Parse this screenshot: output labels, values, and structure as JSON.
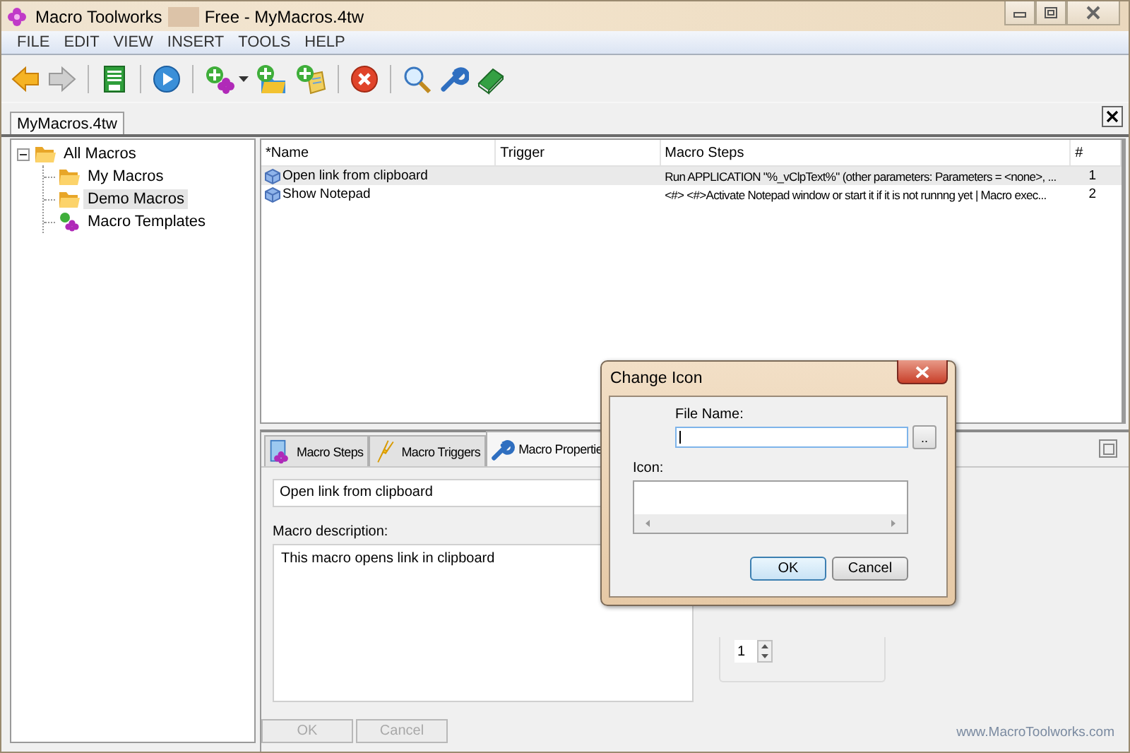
{
  "window": {
    "app_name": "Macro Toolworks",
    "title_rest": "Free - MyMacros.4tw"
  },
  "menu": [
    "FILE",
    "EDIT",
    "VIEW",
    "INSERT",
    "TOOLS",
    "HELP"
  ],
  "toolbar": [
    {
      "kind": "back",
      "disabled": false
    },
    {
      "kind": "forward",
      "disabled": true
    },
    {
      "kind": "sep"
    },
    {
      "kind": "save",
      "disabled": false
    },
    {
      "kind": "sep"
    },
    {
      "kind": "run",
      "disabled": false
    },
    {
      "kind": "sep"
    },
    {
      "kind": "add-macro",
      "disabled": false
    },
    {
      "kind": "dropdown",
      "disabled": false
    },
    {
      "kind": "add-folder",
      "disabled": false
    },
    {
      "kind": "add-template",
      "disabled": false
    },
    {
      "kind": "sep"
    },
    {
      "kind": "delete",
      "disabled": false
    },
    {
      "kind": "sep"
    },
    {
      "kind": "search",
      "disabled": false
    },
    {
      "kind": "settings",
      "disabled": false
    },
    {
      "kind": "help",
      "disabled": false
    }
  ],
  "document_tab": {
    "label": "MyMacros.4tw",
    "selected": true
  },
  "tree": [
    {
      "label": "All Macros",
      "kind": "folder",
      "expanded": true,
      "selected": false,
      "children": [
        {
          "label": "My Macros",
          "kind": "folder",
          "selected": false
        },
        {
          "label": "Demo Macros",
          "kind": "folder",
          "selected": true
        },
        {
          "label": "Macro Templates",
          "kind": "template",
          "selected": false
        }
      ]
    }
  ],
  "table": {
    "columns": [
      "*Name",
      "Trigger",
      "Macro Steps",
      "#"
    ],
    "rows": [
      {
        "name": "Open link from clipboard",
        "steps": "Run APPLICATION \"%_vClpText%\" (other parameters: Parameters = <none>, ...",
        "number": "1",
        "selected": true
      },
      {
        "name": "Show Notepad",
        "steps": "<#> <#>Activate Notepad window or start it if it is not runnng yet | Macro exec...",
        "number": "2",
        "selected": false
      }
    ]
  },
  "panel": {
    "tabs": [
      {
        "label": "Macro Steps",
        "kind": "steps",
        "selected": false
      },
      {
        "label": "Macro Triggers",
        "kind": "triggers",
        "selected": false
      },
      {
        "label": "Macro Propertie",
        "kind": "properties",
        "selected": true
      }
    ],
    "name_value": "Open link from clipboard",
    "description_label": "Macro description:",
    "description_value": "This macro opens link in clipboard",
    "spinner_value": "1",
    "buttons": [
      {
        "label": "OK",
        "disabled": true
      },
      {
        "label": "Cancel",
        "disabled": true
      }
    ],
    "link": "www.MacroToolworks.com"
  },
  "dialog": {
    "title": "Change Icon",
    "file_name_label": "File Name:",
    "browse_label": "..",
    "icon_label": "Icon:",
    "buttons": [
      {
        "label": "OK",
        "default": true
      },
      {
        "label": "Cancel",
        "default": false
      }
    ]
  }
}
